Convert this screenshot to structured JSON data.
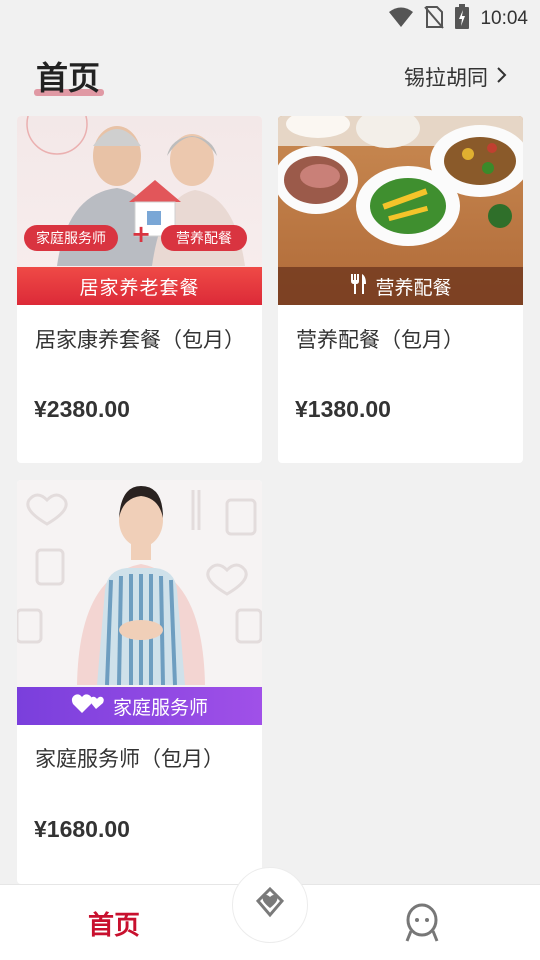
{
  "status_bar": {
    "time": "10:04"
  },
  "header": {
    "title": "首页",
    "location": "锡拉胡同"
  },
  "cards": [
    {
      "banner": "居家养老套餐",
      "tags": [
        "家庭服务师",
        "营养配餐"
      ],
      "name": "居家康养套餐（包月）",
      "price": "¥2380.00"
    },
    {
      "banner": "营养配餐",
      "name": "营养配餐（包月）",
      "price": "¥1380.00"
    },
    {
      "banner": "家庭服务师",
      "name": "家庭服务师（包月）",
      "price": "¥1680.00"
    }
  ],
  "tabbar": {
    "home_label": "首页"
  },
  "colors": {
    "accent": "#c8102e",
    "banner_red": "#e8303a",
    "banner_brown": "#8a4a2c",
    "banner_purple": "#8a44dd"
  }
}
